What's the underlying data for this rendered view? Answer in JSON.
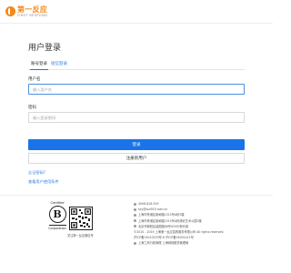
{
  "brand": {
    "name_cn": "第一反应",
    "name_en": "FIRST RESPOND"
  },
  "page_title": "用户登录",
  "tabs": [
    {
      "label": "账号登录",
      "active": true
    },
    {
      "label": "短信登录",
      "active": false
    }
  ],
  "form": {
    "username_label": "用户名",
    "username_placeholder": "输入用户名",
    "password_label": "密码",
    "password_placeholder": "输入登录密码",
    "login_button": "登录",
    "register_button": "注册新用户",
    "forgot_link": "忘记密码?",
    "terms_link": "查看用户使用条件"
  },
  "footer": {
    "bcorp_certified": "Certified",
    "bcorp_letter": "B",
    "bcorp_corporation": "Corporation",
    "qr_label": "关注第一反应微信号",
    "lines": [
      "4008-818-919",
      "ssy@ssx919.com.cn",
      "上海市黄浦区新闸路1515号A栋3楼",
      "上海市黄浦区新闸路1515号A栋静安艺术公园3楼",
      "北京市朝阳区建国路88号SOHO现代城",
      "©2010 - 2019 上海第一反应急救服务有限公司 All rights reserved.",
      "沪ICP备15010153号-6  沪ICP备16001411号",
      "上海工商行政管理   上海网络服务管理局"
    ]
  },
  "colors": {
    "brand_orange": "#f08a1c",
    "primary_blue": "#1a73e8",
    "link_blue": "#2f7de1"
  }
}
